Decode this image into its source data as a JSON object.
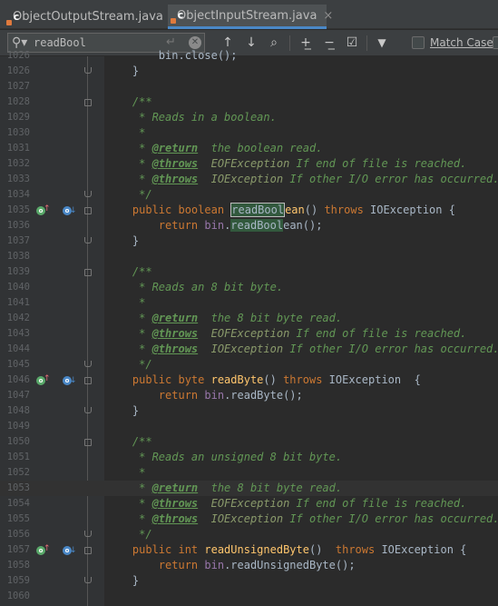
{
  "tabs": [
    {
      "icon": "c",
      "label": "ObjectOutputStream.java",
      "close": "×"
    },
    {
      "icon": "c",
      "label": "ObjectInputStream.java",
      "close": "×"
    }
  ],
  "search": {
    "value": "readBool",
    "enter_glyph": "↵",
    "clear_glyph": "✕"
  },
  "toolbar": {
    "prev_glyph": "↑",
    "next_glyph": "↓",
    "find_all_glyph": "⌕",
    "add_occ_glyph": "+̲",
    "remove_occ_glyph": "−̲",
    "select_all_glyph": "☑",
    "filter_glyph": "▼",
    "match_case_label": "Match Case"
  },
  "gutter": {
    "override_badge": "o",
    "override_arrow": "↑",
    "implemented_badge": "o",
    "implemented_arrow": "↓"
  },
  "code": [
    {
      "n": "1026",
      "t": [
        [
          "plain",
          "        bin.close();"
        ]
      ]
    },
    {
      "n": "1026",
      "t": [
        [
          "plain",
          "    }"
        ]
      ]
    },
    {
      "n": "1027",
      "t": []
    },
    {
      "n": "1028",
      "t": [
        [
          "doc",
          "    /**"
        ]
      ]
    },
    {
      "n": "1029",
      "t": [
        [
          "doc",
          "     * Reads in a boolean."
        ]
      ]
    },
    {
      "n": "1030",
      "t": [
        [
          "doc",
          "     *"
        ]
      ]
    },
    {
      "n": "1031",
      "t": [
        [
          "doc",
          "     * "
        ],
        [
          "tag",
          "@return"
        ],
        [
          "doc",
          "  the boolean read."
        ]
      ]
    },
    {
      "n": "1032",
      "t": [
        [
          "doc",
          "     * "
        ],
        [
          "tag",
          "@throws"
        ],
        [
          "doc",
          "  "
        ],
        [
          "docname",
          "EOFException"
        ],
        [
          "doc",
          " If end of file is reached."
        ]
      ]
    },
    {
      "n": "1033",
      "t": [
        [
          "doc",
          "     * "
        ],
        [
          "tag",
          "@throws"
        ],
        [
          "doc",
          "  "
        ],
        [
          "docname",
          "IOException"
        ],
        [
          "doc",
          " If other I/O error has occurred."
        ]
      ]
    },
    {
      "n": "1034",
      "t": [
        [
          "doc",
          "     */"
        ]
      ]
    },
    {
      "n": "1035",
      "t": [
        [
          "kw",
          "    public boolean "
        ],
        [
          "hlb",
          "readBool"
        ],
        [
          "fn",
          "ean"
        ],
        [
          "plain",
          "() "
        ],
        [
          "kw",
          "throws "
        ],
        [
          "plain",
          "IOException {"
        ]
      ]
    },
    {
      "n": "1036",
      "t": [
        [
          "kw",
          "        return "
        ],
        [
          "fld",
          "bin"
        ],
        [
          "plain",
          "."
        ],
        [
          "hl",
          "readBool"
        ],
        [
          "plain",
          "ean();"
        ]
      ]
    },
    {
      "n": "1037",
      "t": [
        [
          "plain",
          "    }"
        ]
      ]
    },
    {
      "n": "1038",
      "t": []
    },
    {
      "n": "1039",
      "t": [
        [
          "doc",
          "    /**"
        ]
      ]
    },
    {
      "n": "1040",
      "t": [
        [
          "doc",
          "     * Reads an 8 bit byte."
        ]
      ]
    },
    {
      "n": "1041",
      "t": [
        [
          "doc",
          "     *"
        ]
      ]
    },
    {
      "n": "1042",
      "t": [
        [
          "doc",
          "     * "
        ],
        [
          "tag",
          "@return"
        ],
        [
          "doc",
          "  the 8 bit byte read."
        ]
      ]
    },
    {
      "n": "1043",
      "t": [
        [
          "doc",
          "     * "
        ],
        [
          "tag",
          "@throws"
        ],
        [
          "doc",
          "  "
        ],
        [
          "docname",
          "EOFException"
        ],
        [
          "doc",
          " If end of file is reached."
        ]
      ]
    },
    {
      "n": "1044",
      "t": [
        [
          "doc",
          "     * "
        ],
        [
          "tag",
          "@throws"
        ],
        [
          "doc",
          "  "
        ],
        [
          "docname",
          "IOException"
        ],
        [
          "doc",
          " If other I/O error has occurred."
        ]
      ]
    },
    {
      "n": "1045",
      "t": [
        [
          "doc",
          "     */"
        ]
      ]
    },
    {
      "n": "1046",
      "t": [
        [
          "kw",
          "    public byte "
        ],
        [
          "fn",
          "readByte"
        ],
        [
          "plain",
          "() "
        ],
        [
          "kw",
          "throws "
        ],
        [
          "plain",
          "IOException  {"
        ]
      ]
    },
    {
      "n": "1047",
      "t": [
        [
          "kw",
          "        return "
        ],
        [
          "fld",
          "bin"
        ],
        [
          "plain",
          ".readByte();"
        ]
      ]
    },
    {
      "n": "1048",
      "t": [
        [
          "plain",
          "    }"
        ]
      ]
    },
    {
      "n": "1049",
      "t": []
    },
    {
      "n": "1050",
      "t": [
        [
          "doc",
          "    /**"
        ]
      ]
    },
    {
      "n": "1051",
      "t": [
        [
          "doc",
          "     * Reads an unsigned 8 bit byte."
        ]
      ]
    },
    {
      "n": "1052",
      "t": [
        [
          "doc",
          "     *"
        ]
      ]
    },
    {
      "n": "1053",
      "t": [
        [
          "doc",
          "     * "
        ],
        [
          "tag",
          "@return"
        ],
        [
          "doc",
          "  the 8 bit byte read."
        ]
      ]
    },
    {
      "n": "1054",
      "t": [
        [
          "doc",
          "     * "
        ],
        [
          "tag",
          "@throws"
        ],
        [
          "doc",
          "  "
        ],
        [
          "docname",
          "EOFException"
        ],
        [
          "doc",
          " If end of file is reached."
        ]
      ]
    },
    {
      "n": "1055",
      "t": [
        [
          "doc",
          "     * "
        ],
        [
          "tag",
          "@throws"
        ],
        [
          "doc",
          "  "
        ],
        [
          "docname",
          "IOException"
        ],
        [
          "doc",
          " If other I/O error has occurred."
        ]
      ]
    },
    {
      "n": "1056",
      "t": [
        [
          "doc",
          "     */"
        ]
      ]
    },
    {
      "n": "1057",
      "t": [
        [
          "kw",
          "    public int "
        ],
        [
          "fn",
          "readUnsignedByte"
        ],
        [
          "plain",
          "()  "
        ],
        [
          "kw",
          "throws "
        ],
        [
          "plain",
          "IOException {"
        ]
      ]
    },
    {
      "n": "1058",
      "t": [
        [
          "kw",
          "        return "
        ],
        [
          "fld",
          "bin"
        ],
        [
          "plain",
          ".readUnsignedByte();"
        ]
      ]
    },
    {
      "n": "1059",
      "t": [
        [
          "plain",
          "    }"
        ]
      ]
    },
    {
      "n": "1060",
      "t": []
    }
  ]
}
